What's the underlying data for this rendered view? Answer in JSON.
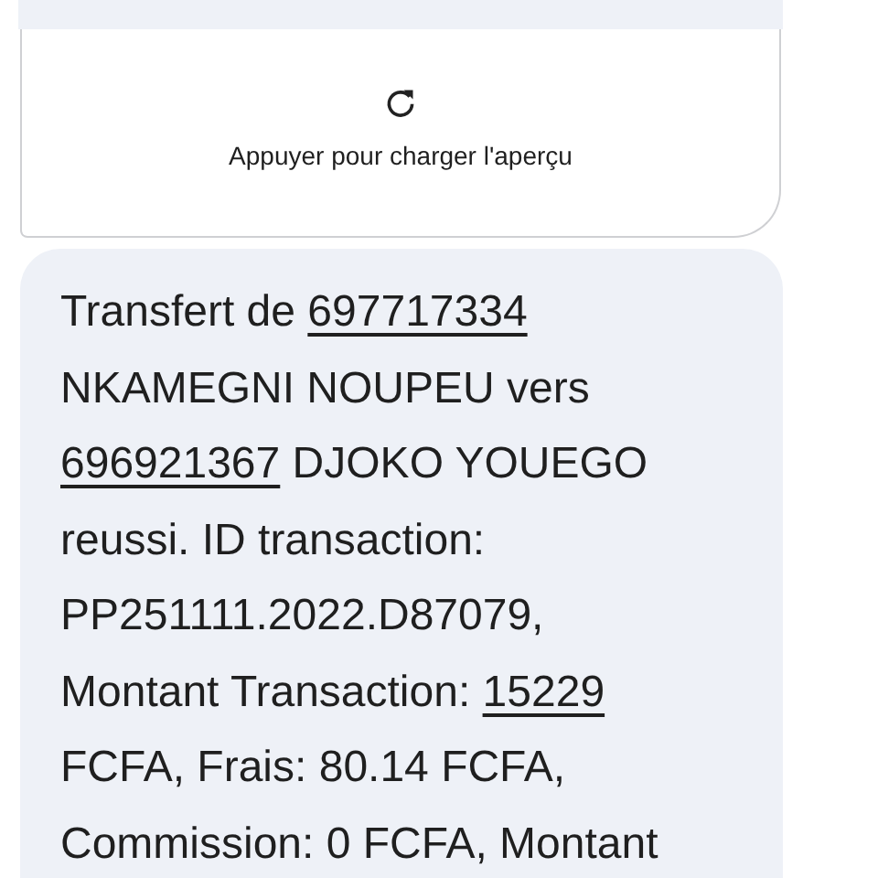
{
  "preview": {
    "label": "Appuyer pour charger l'aperçu"
  },
  "message": {
    "segments": [
      {
        "kind": "text",
        "text": "Transfert de "
      },
      {
        "kind": "link",
        "text": "697717334"
      },
      {
        "kind": "text",
        "text": "\nNKAMEGNI NOUPEU vers\n"
      },
      {
        "kind": "link",
        "text": "696921367"
      },
      {
        "kind": "text",
        "text": " DJOKO YOUEGO\nreussi. ID transaction:\nPP251111.2022.D87079,\nMontant Transaction: "
      },
      {
        "kind": "link",
        "text": "15229"
      },
      {
        "kind": "text",
        "text": "\nFCFA, Frais: 80.14 FCFA,\nCommission: 0 FCFA, Montant"
      }
    ]
  }
}
